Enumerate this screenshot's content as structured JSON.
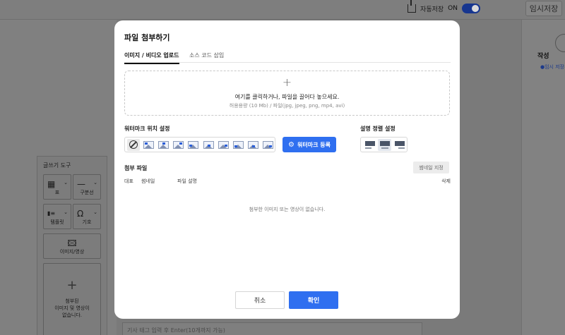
{
  "background": {
    "autosave_label": "자동저장",
    "autosave_state": "ON",
    "temp_save_label": "임시저장",
    "right_panel_title": "작성",
    "right_panel_note": "●임시 저장된",
    "tag_input_placeholder": "기사 태그 입력 후 Enter(10개까지 가능)",
    "tools": {
      "title": "글쓰기 도구",
      "items": [
        {
          "label": "표",
          "icon": "table-icon"
        },
        {
          "label": "구분선",
          "icon": "divider-icon"
        },
        {
          "label": "템플릿",
          "icon": "template-icon"
        },
        {
          "label": "기호",
          "icon": "omega-icon"
        },
        {
          "label": "이미지/영상",
          "icon": "image-icon"
        }
      ],
      "attached_placeholder_line1": "첨부된",
      "attached_placeholder_line2": "이미지 및 영상이",
      "attached_placeholder_line3": "없습니다."
    }
  },
  "modal": {
    "title": "파일 첨부하기",
    "tabs": [
      {
        "label": "이미지 / 비디오 업로드",
        "active": true
      },
      {
        "label": "소스 코드 삽입",
        "active": false
      }
    ],
    "dropzone": {
      "main": "여기를 클릭하거나, 파일을 끌어다 놓으세요.",
      "sub": "허용용량 (10 Mb) / 파일(jpg, jpeg, png, mp4, avi)"
    },
    "watermark": {
      "label": "워터마크 위치 설정",
      "register_label": "워터마크 등록"
    },
    "align": {
      "label": "설명 정렬 설정"
    },
    "attachments": {
      "label": "첨부 파일",
      "thumbnail_button": "썸네일 지정",
      "columns": [
        "대표",
        "썸네일",
        "파일 설명",
        "삭제"
      ],
      "empty_message": "첨부한 이미지 또는 영상이 없습니다."
    },
    "cancel_label": "취소",
    "confirm_label": "확인"
  },
  "colors": {
    "primary": "#2f6ff0",
    "overlay": "#808080"
  }
}
